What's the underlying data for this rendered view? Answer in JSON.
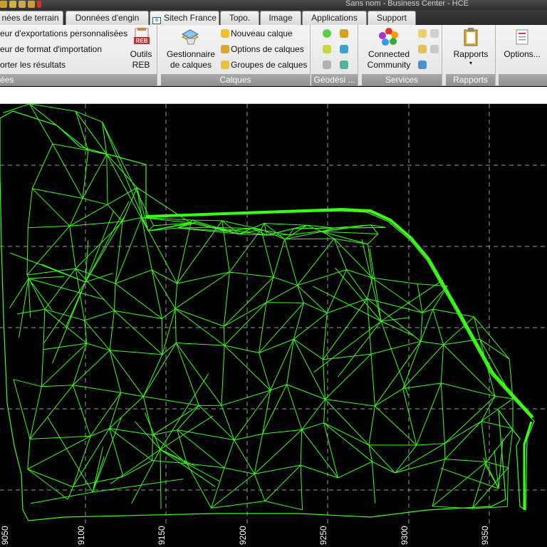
{
  "window": {
    "title": "Sans nom - Business Center - HCE"
  },
  "tabs": [
    {
      "label": "nées de terrain",
      "active": false
    },
    {
      "label": "Données d'engin",
      "active": false
    },
    {
      "label": "Sitech France",
      "active": true,
      "icon": "sitech-logo-icon"
    },
    {
      "label": "Topo.",
      "active": false
    },
    {
      "label": "Image",
      "active": false
    },
    {
      "label": "Applications",
      "active": false
    },
    {
      "label": "Support",
      "active": false
    }
  ],
  "ribbon": {
    "data_group": {
      "label": "ées",
      "items": [
        "eur d'exportations personnalisées",
        "eur de format d'importation",
        "orter les résultats"
      ],
      "outils_reb": {
        "line1": "Outils",
        "line2": "REB",
        "badge": "REB"
      }
    },
    "calques_group": {
      "label": "Calques",
      "manager": {
        "line1": "Gestionnaire",
        "line2": "de calques"
      },
      "items": [
        "Nouveau calque",
        "Options de calques",
        "Groupes de calques"
      ]
    },
    "geodesie_group": {
      "label": "Géodési ..."
    },
    "services_group": {
      "label": "Services",
      "connected": {
        "line1": "Connected",
        "line2": "Community"
      }
    },
    "rapports_group": {
      "label": "Rapports",
      "button": "Rapports"
    },
    "options_group": {
      "button": "Options..."
    }
  },
  "cad": {
    "x_ticks": [
      "9100",
      "9150",
      "9200",
      "9250",
      "9300",
      "9350"
    ],
    "colors": {
      "background": "#000000",
      "mesh": "#39ff14",
      "grid": "#9a9a9a"
    }
  }
}
